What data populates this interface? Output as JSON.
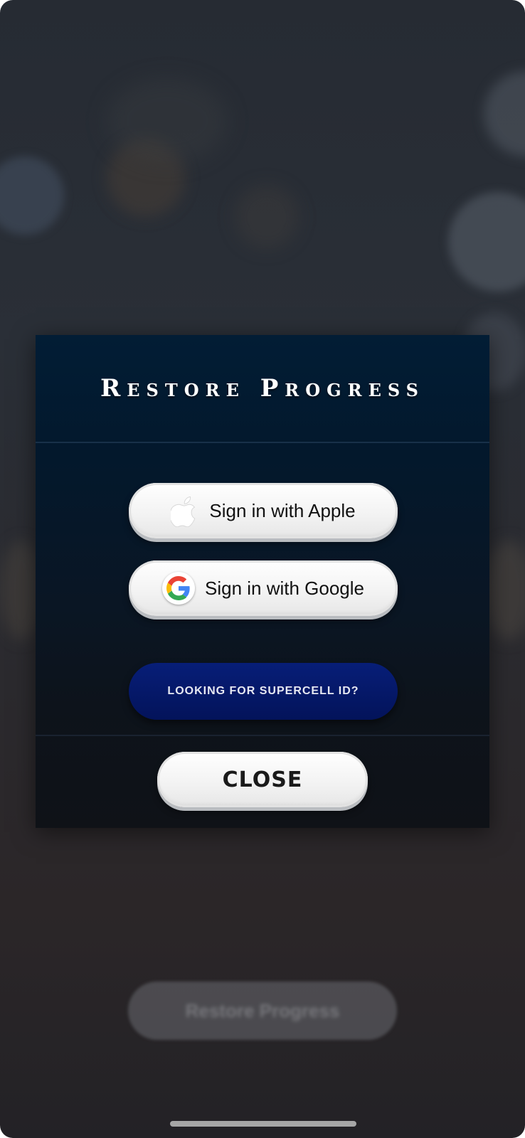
{
  "background": {
    "restore_button_label": "Restore Progress"
  },
  "dialog": {
    "title": "Restore Progress",
    "apple_button": {
      "label": "Sign in with Apple",
      "icon": "apple-icon"
    },
    "google_button": {
      "label": "Sign in with Google",
      "icon": "google-icon"
    },
    "supercell_button": {
      "label": "LOOKING FOR SUPERCELL ID?"
    },
    "close_button": {
      "label": "CLOSE"
    }
  },
  "colors": {
    "dialog_bg": "#021d35",
    "supercell_button_bg": "#071e78",
    "button_face": "#f2f2f2"
  }
}
